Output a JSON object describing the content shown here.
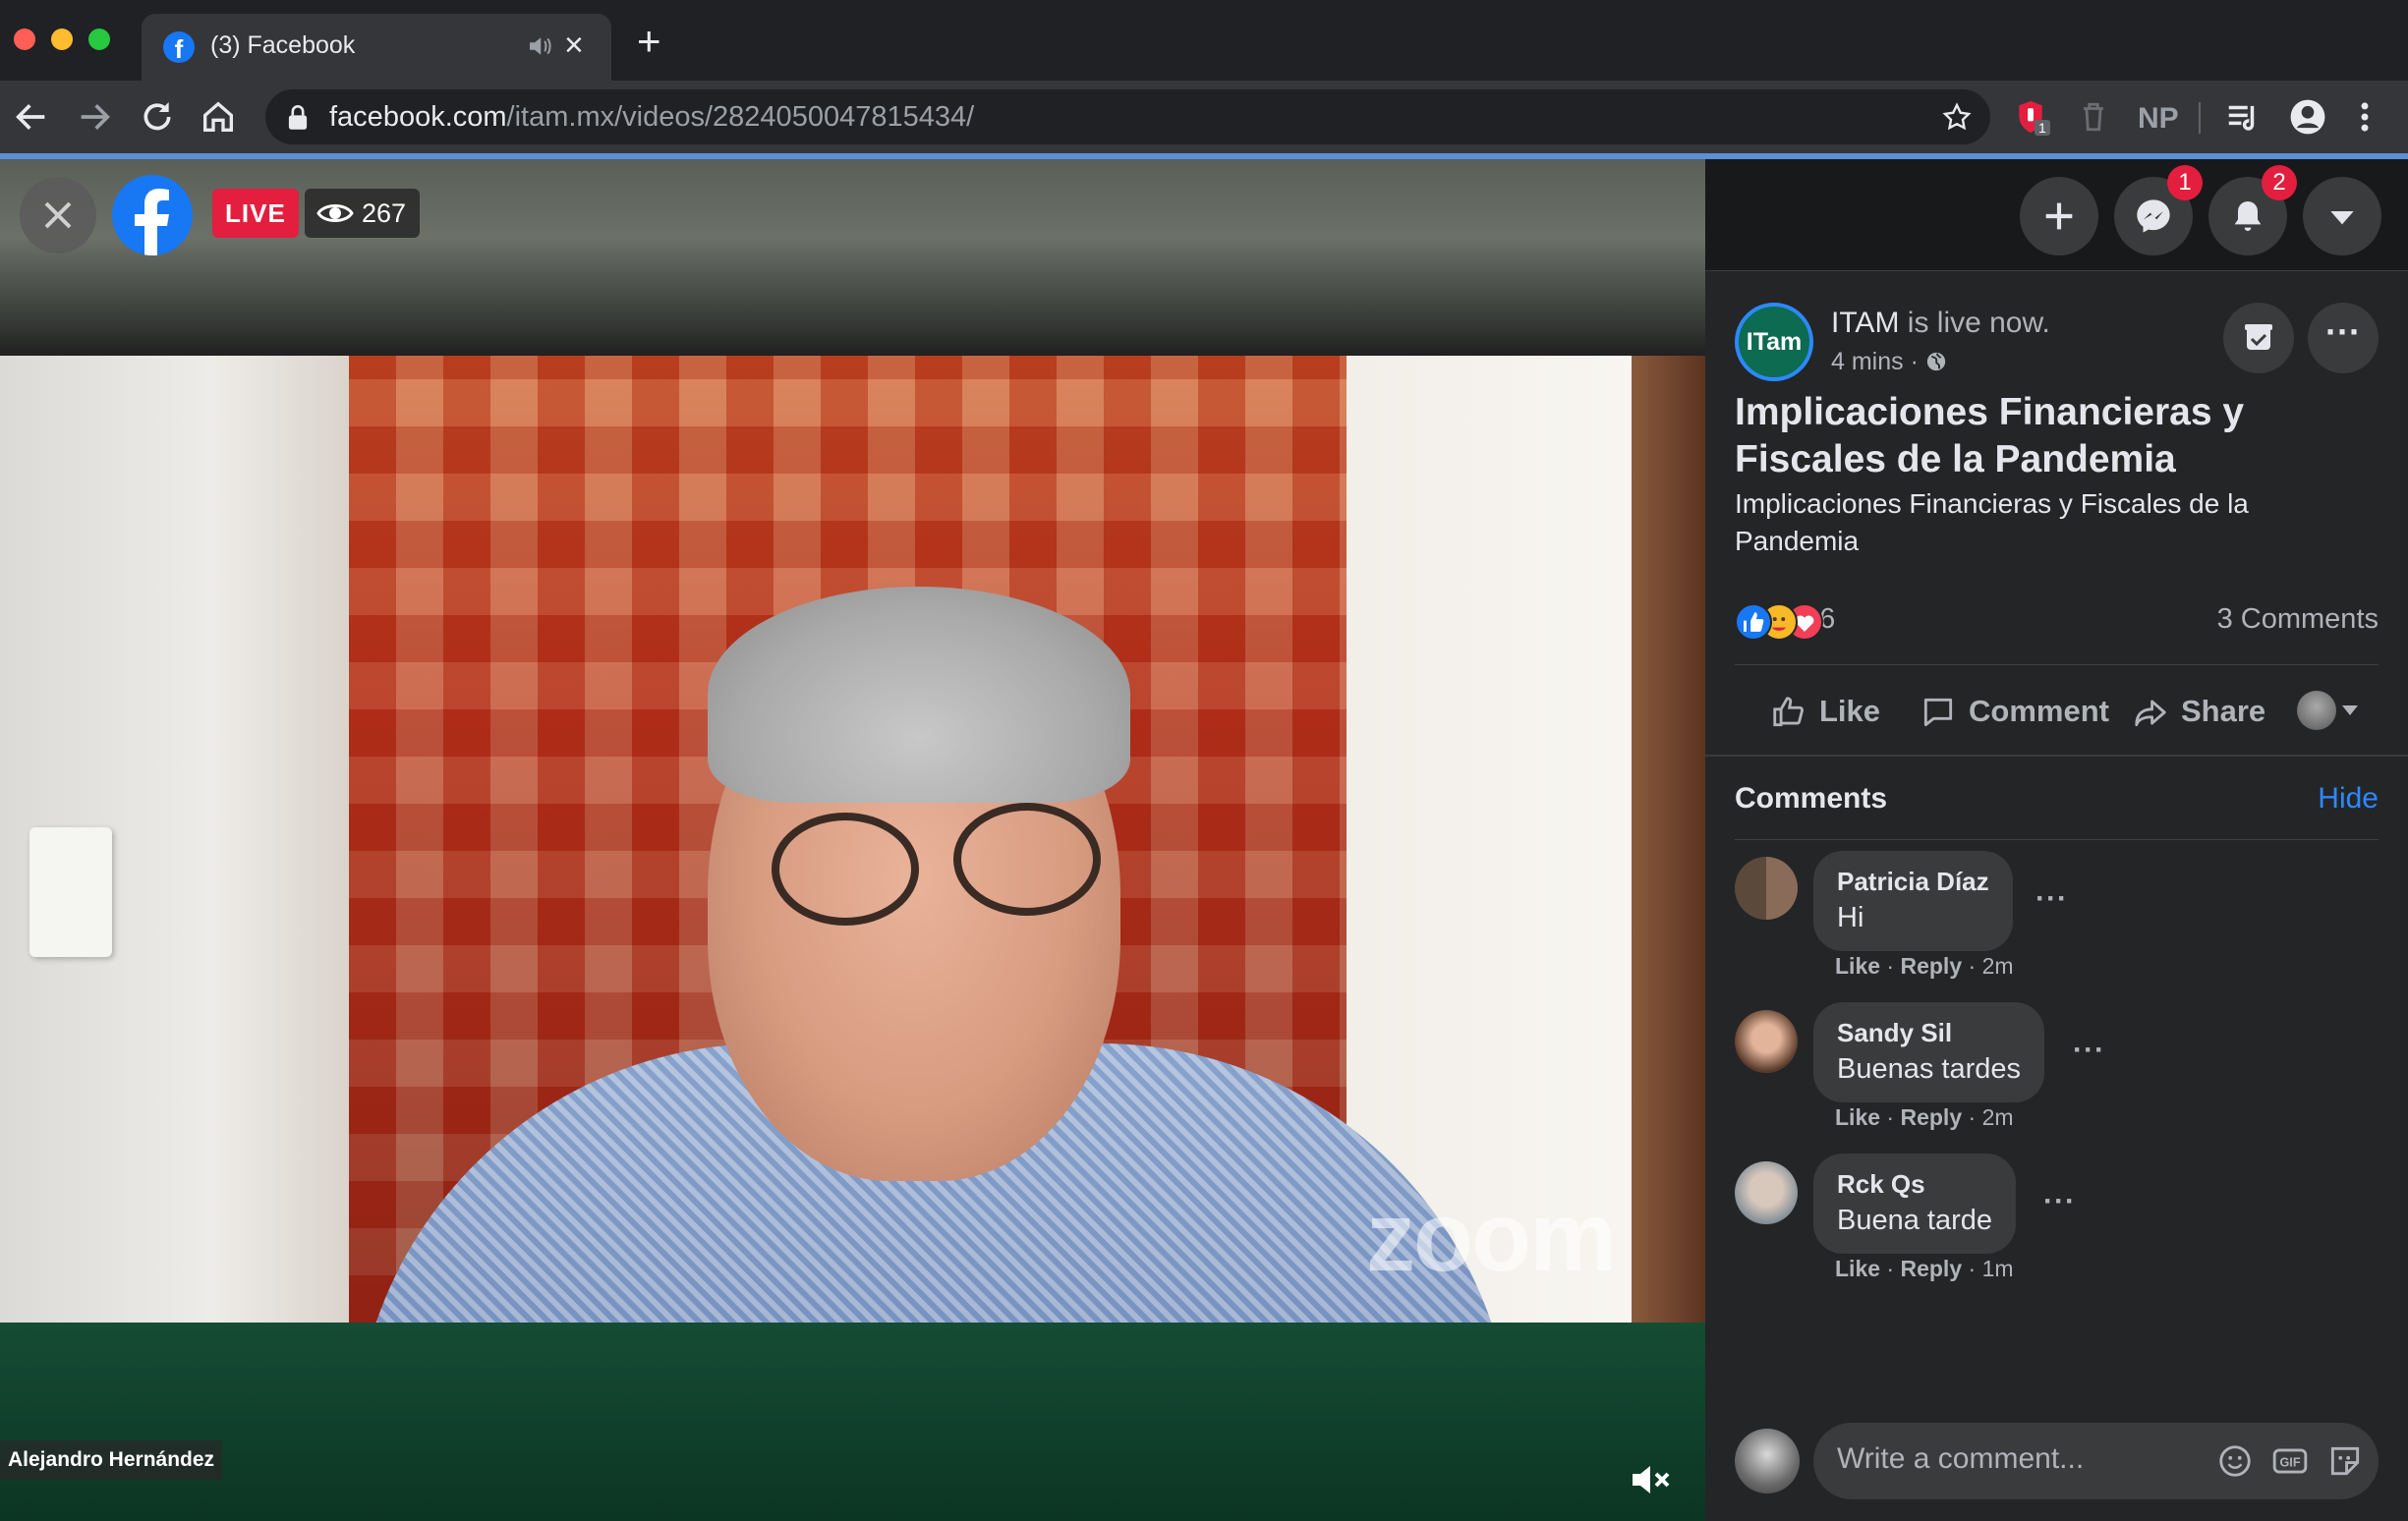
{
  "browser": {
    "tab_title": "(3) Facebook",
    "tab_favicon": "f",
    "url_domain": "facebook.com",
    "url_path": "/itam.mx/videos/2824050047815434/",
    "ext_badge": "1",
    "ext_np": "NP"
  },
  "video": {
    "live_label": "LIVE",
    "viewer_count": "267",
    "speaker_name": "Alejandro Hernández",
    "watermark": "zoom"
  },
  "topbar": {
    "messenger_badge": "1",
    "notifications_badge": "2"
  },
  "post": {
    "page_avatar_text": "ITam",
    "page_name": "ITAM",
    "status": " is live now.",
    "time": "4 mins · ",
    "title": "Implicaciones Financieras y Fiscales de la Pandemia",
    "description": "Implicaciones Financieras y Fiscales de la Pandemia",
    "reaction_count": "36",
    "comment_count": "3 Comments",
    "actions": {
      "like": "Like",
      "comment": "Comment",
      "share": "Share"
    }
  },
  "comments": {
    "heading": "Comments",
    "hide": "Hide",
    "items": [
      {
        "name": "Patricia Díaz",
        "text": "Hi",
        "like": "Like",
        "reply": "Reply",
        "time": "2m",
        "dots": "···"
      },
      {
        "name": "Sandy Sil",
        "text": "Buenas tardes",
        "like": "Like",
        "reply": "Reply",
        "time": "2m",
        "dots": "···"
      },
      {
        "name": "Rck Qs",
        "text": "Buena tarde",
        "like": "Like",
        "reply": "Reply",
        "time": "1m",
        "dots": "···"
      }
    ],
    "write_placeholder": "Write a comment..."
  },
  "colors": {
    "facebook_blue": "#1877f2",
    "live_red": "#e41e3f",
    "link_blue": "#2d88ff",
    "panel_bg": "#242526"
  },
  "icons": [
    "facebook-icon",
    "audio-icon",
    "close-icon",
    "plus-icon",
    "back-icon",
    "forward-icon",
    "reload-icon",
    "home-icon",
    "lock-icon",
    "star-icon",
    "menu-icon",
    "eye-icon",
    "messenger-icon",
    "bell-icon",
    "caret-down-icon",
    "globe-icon",
    "bookmark-icon",
    "like-icon",
    "comment-icon",
    "share-icon",
    "emoji-icon",
    "gif-icon",
    "sticker-icon",
    "mute-icon"
  ]
}
